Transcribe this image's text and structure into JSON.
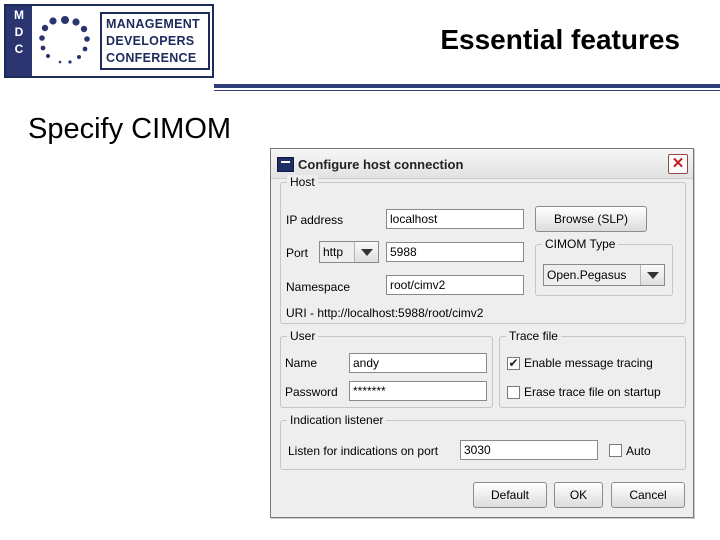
{
  "slide": {
    "logo_letters": [
      "M",
      "D",
      "C"
    ],
    "logo_lines": [
      "MANAGEMENT",
      "DEVELOPERS",
      "CONFERENCE"
    ],
    "title": "Essential features",
    "heading": "Specify CIMOM"
  },
  "dialog": {
    "title": "Configure host connection",
    "close_symbol": "✕",
    "host": {
      "legend": "Host",
      "ip_label": "IP address",
      "ip_value": "localhost",
      "port_label": "Port",
      "port_protocol": "http",
      "port_value": "5988",
      "namespace_label": "Namespace",
      "namespace_value": "root/cimv2",
      "uri_text": "URI - http://localhost:5988/root/cimv2",
      "browse_label": "Browse (SLP)",
      "cimom_type_legend": "CIMOM Type",
      "cimom_type_value": "Open.Pegasus"
    },
    "user": {
      "legend": "User",
      "name_label": "Name",
      "name_value": "andy",
      "password_label": "Password",
      "password_value": "*******"
    },
    "trace": {
      "legend": "Trace file",
      "enable_label": "Enable message tracing",
      "enable_checked": "✔",
      "erase_label": "Erase trace file on startup"
    },
    "indication": {
      "legend": "Indication listener",
      "port_label": "Listen for indications on port",
      "port_value": "3030",
      "auto_label": "Auto"
    },
    "buttons": {
      "default": "Default",
      "ok": "OK",
      "cancel": "Cancel"
    }
  },
  "colors": {
    "brand_navy": "#1d2a5c",
    "rule_blue": "#2f3d7b"
  }
}
